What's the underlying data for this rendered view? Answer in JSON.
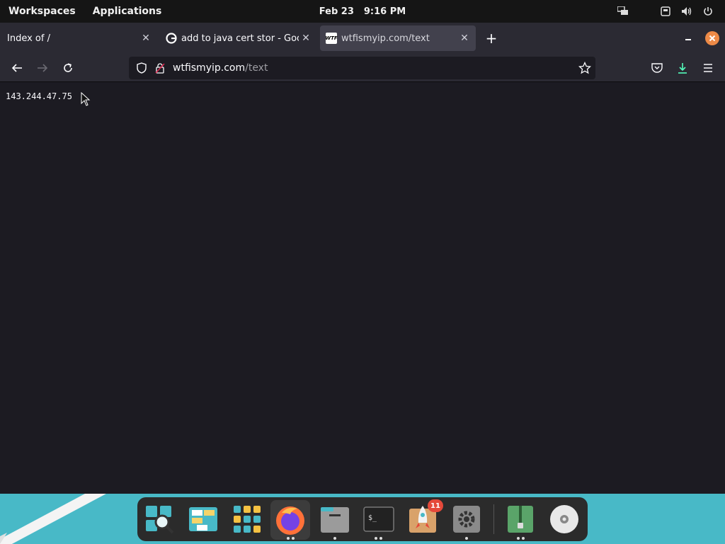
{
  "top_panel": {
    "workspaces_label": "Workspaces",
    "applications_label": "Applications",
    "date": "Feb 23",
    "time": "9:16 PM"
  },
  "tabs": [
    {
      "title": "Index of /",
      "active": false
    },
    {
      "title": "add to java cert stor - Goog",
      "active": false,
      "favicon": "google-icon"
    },
    {
      "title": "wtfismyip.com/text",
      "active": true,
      "favicon": "wtf-icon"
    }
  ],
  "wtf_favicon_text": "WTF",
  "navbar": {
    "url_host": "wtfismyip.com",
    "url_path": "/text"
  },
  "content": {
    "ip_address": "143.244.47.75"
  },
  "dock": {
    "update_badge_count": "11",
    "terminal_prompt": "$_"
  },
  "colors": {
    "accent_close": "#ed8a47",
    "desktop_bg": "#48b9c7",
    "page_bg": "#1c1b22"
  }
}
